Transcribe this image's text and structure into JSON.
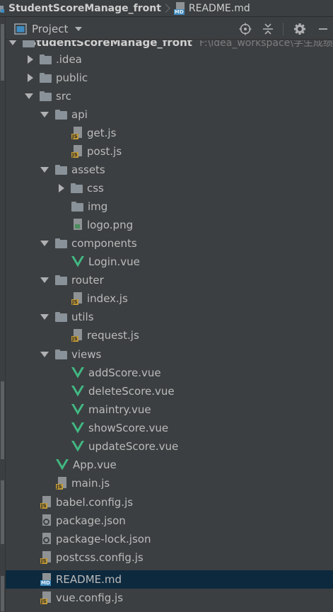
{
  "breadcrumb": {
    "project": "StudentScoreManage_front",
    "file": "README.md",
    "file_badge": "MD"
  },
  "project_panel": {
    "view_label": "Project",
    "actions": [
      "locate-icon",
      "collapse-all-icon",
      "settings-gear-icon",
      "hide-icon"
    ]
  },
  "tree": {
    "root": {
      "name": "StudentScoreManage_front",
      "path": "F:\\idea_workspace\\学生成绩"
    },
    "idea": ".idea",
    "public": "public",
    "src": "src",
    "api": "api",
    "get_js": "get.js",
    "post_js": "post.js",
    "assets": "assets",
    "css": "css",
    "img": "img",
    "logo_png": "logo.png",
    "components": "components",
    "login_vue": "Login.vue",
    "router": "router",
    "router_index_js": "index.js",
    "utils": "utils",
    "request_js": "request.js",
    "views": "views",
    "addscore_vue": "addScore.vue",
    "deletescore_vue": "deleteScore.vue",
    "maintry_vue": "maintry.vue",
    "showscore_vue": "showScore.vue",
    "updatescore_vue": "updateScore.vue",
    "app_vue": "App.vue",
    "main_js": "main.js",
    "babel_config_js": "babel.config.js",
    "package_json": "package.json",
    "package_lock_json": "package-lock.json",
    "postcss_config_js": "postcss.config.js",
    "readme_md": "README.md",
    "vue_config_js": "vue.config.js",
    "js_badge": "JS",
    "md_badge": "MD"
  },
  "colors": {
    "background": "#3c3f41",
    "selection": "#0d293e",
    "text": "#bbbbbb",
    "folder": "#8a9299",
    "js_badge": "#c29a36",
    "md_badge": "#3f8bbf",
    "vue_green": "#41b883"
  }
}
